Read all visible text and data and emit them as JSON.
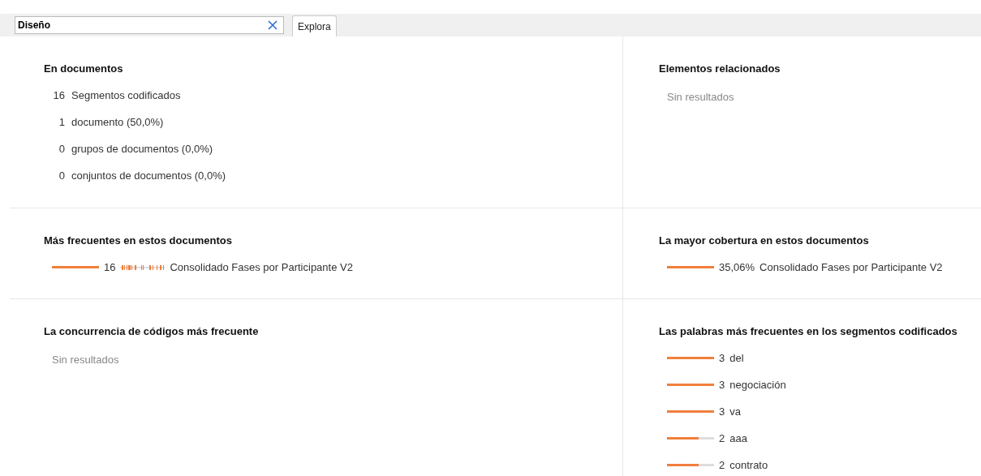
{
  "search": {
    "value": "Diseño",
    "button": "Explora"
  },
  "left": [
    {
      "kind": "stats",
      "title": "En documentos",
      "rows": [
        {
          "count": "16",
          "label": "Segmentos codificados"
        },
        {
          "count": "1",
          "label": "documento (50,0%)"
        },
        {
          "count": "0",
          "label": "grupos de documentos (0,0%)"
        },
        {
          "count": "0",
          "label": "conjuntos de documentos (0,0%)"
        }
      ]
    },
    {
      "kind": "bars",
      "title": "Más frecuentes en estos documentos",
      "rows": [
        {
          "level": 1,
          "value": "16",
          "distribution": true,
          "label": "Consolidado Fases por Participante V2"
        }
      ]
    },
    {
      "kind": "empty",
      "title": "La concurrencia de códigos más frecuente",
      "message": "Sin resultados"
    }
  ],
  "right": [
    {
      "kind": "empty",
      "title": "Elementos relacionados",
      "message": "Sin resultados"
    },
    {
      "kind": "bars",
      "title": "La mayor cobertura en estos documentos",
      "rows": [
        {
          "level": 1,
          "value": "35,06%",
          "distribution": false,
          "label": "Consolidado Fases por Participante V2"
        }
      ]
    },
    {
      "kind": "bars",
      "title": "Las palabras más frecuentes en los segmentos codificados",
      "rows": [
        {
          "level": 1,
          "value": "3",
          "distribution": false,
          "label": "del"
        },
        {
          "level": 1,
          "value": "3",
          "distribution": false,
          "label": "negociación"
        },
        {
          "level": 1,
          "value": "3",
          "distribution": false,
          "label": "va"
        },
        {
          "level": 0.67,
          "value": "2",
          "distribution": false,
          "label": "aaa"
        },
        {
          "level": 0.67,
          "value": "2",
          "distribution": false,
          "label": "contrato"
        }
      ]
    }
  ]
}
